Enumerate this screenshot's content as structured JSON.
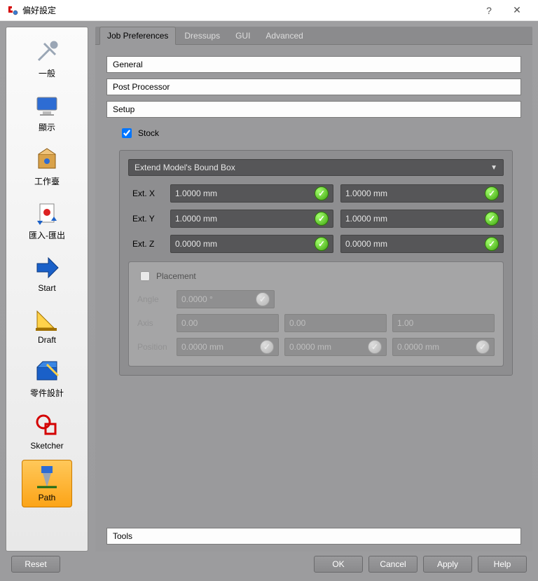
{
  "window": {
    "title": "偏好設定"
  },
  "titlebar_controls": {
    "help": "?",
    "close": "✕"
  },
  "sidebar": {
    "items": [
      {
        "id": "general",
        "label": "一般"
      },
      {
        "id": "display",
        "label": "顯示"
      },
      {
        "id": "workbench",
        "label": "工作臺"
      },
      {
        "id": "impexp",
        "label": "匯入-匯出"
      },
      {
        "id": "start",
        "label": "Start"
      },
      {
        "id": "draft",
        "label": "Draft"
      },
      {
        "id": "partdes",
        "label": "零件設計"
      },
      {
        "id": "sketcher",
        "label": "Sketcher"
      },
      {
        "id": "path",
        "label": "Path",
        "selected": true
      }
    ]
  },
  "tabs": [
    {
      "id": "jobprefs",
      "label": "Job Preferences",
      "active": true
    },
    {
      "id": "dressups",
      "label": "Dressups"
    },
    {
      "id": "gui",
      "label": "GUI"
    },
    {
      "id": "advanced",
      "label": "Advanced"
    }
  ],
  "sections": {
    "general": "General",
    "postproc": "Post Processor",
    "setup": "Setup",
    "tools": "Tools"
  },
  "stock": {
    "label": "Stock",
    "checked": true,
    "mode": "Extend Model's Bound Box",
    "ext": {
      "x_label": "Ext. X",
      "x1": "1.0000 mm",
      "x2": "1.0000 mm",
      "y_label": "Ext. Y",
      "y1": "1.0000 mm",
      "y2": "1.0000 mm",
      "z_label": "Ext. Z",
      "z1": "0.0000 mm",
      "z2": "0.0000 mm"
    }
  },
  "placement": {
    "label": "Placement",
    "checked": false,
    "angle_label": "Angle",
    "angle": "0.0000 °",
    "axis_label": "Axis",
    "axis_x": "0.00",
    "axis_y": "0.00",
    "axis_z": "1.00",
    "pos_label": "Position",
    "pos_x": "0.0000 mm",
    "pos_y": "0.0000 mm",
    "pos_z": "0.0000 mm"
  },
  "buttons": {
    "reset": "Reset",
    "ok": "OK",
    "cancel": "Cancel",
    "apply": "Apply",
    "help": "Help"
  }
}
